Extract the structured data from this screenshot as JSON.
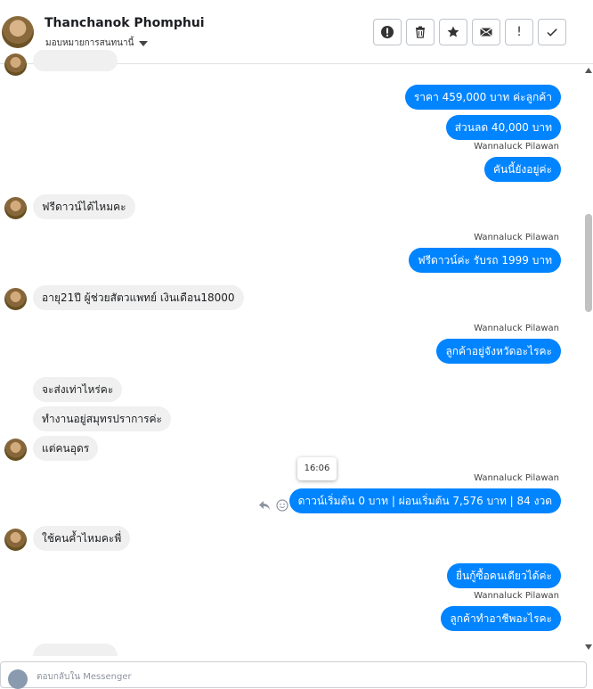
{
  "header": {
    "contact_name": "Thanchanok Phomphui",
    "assign_label": "มอบหมายการสนทนานี้"
  },
  "actions": [
    {
      "name": "flag-spam-button",
      "icon": "alert-circle-icon"
    },
    {
      "name": "delete-button",
      "icon": "trash-icon"
    },
    {
      "name": "star-button",
      "icon": "star-icon"
    },
    {
      "name": "mark-unread-button",
      "icon": "envelope-icon"
    },
    {
      "name": "mark-important-button",
      "icon": "exclamation-icon",
      "glyph": "!"
    },
    {
      "name": "mark-done-button",
      "icon": "check-icon"
    }
  ],
  "messages": [
    {
      "text": "ราคา 459,000 บาท ค่ะลูกค้า"
    },
    {
      "text": "ส่วนลด 40,000 บาท"
    },
    {
      "sender": "Wannaluck Pilawan",
      "text": "คันนี้ยังอยู่ค่ะ"
    },
    {
      "text": "ฟรีดาวน์ได้ไหมคะ"
    },
    {
      "sender": "Wannaluck Pilawan",
      "text": "ฟรีดาวน์ค่ะ รับรถ 1999 บาท"
    },
    {
      "text": "อายุ21ปี ผู้ช่วยสัตวแพทย์ เงินเดือน18000"
    },
    {
      "sender": "Wannaluck Pilawan",
      "text": "ลูกค้าอยู่จังหวัดอะไรคะ"
    },
    {
      "text": "จะส่งเท่าไหร่คะ"
    },
    {
      "text": "ทำงานอยู่สมุทรปราการค่ะ"
    },
    {
      "text": "แต่คนอุดร"
    },
    {
      "tooltip_time": "16:06",
      "sender": "Wannaluck Pilawan",
      "text": "ดาวน์เริ่มต้น 0 บาท | ผ่อนเริ่มต้น 7,576  บาท | 84 งวด"
    },
    {
      "text": "ใช้คนค้ำไหมคะพี่"
    },
    {
      "text": "ยื่นกู้ซื้อคนเดียวได้ค่ะ"
    },
    {
      "sender": "Wannaluck Pilawan",
      "text": "ลูกค้าทำอาชีพอะไรคะ"
    }
  ],
  "composer": {
    "placeholder": "ตอบกลับใน Messenger"
  },
  "colors": {
    "outgoing_bubble": "#0084ff",
    "incoming_bubble": "#f0f0f0"
  }
}
